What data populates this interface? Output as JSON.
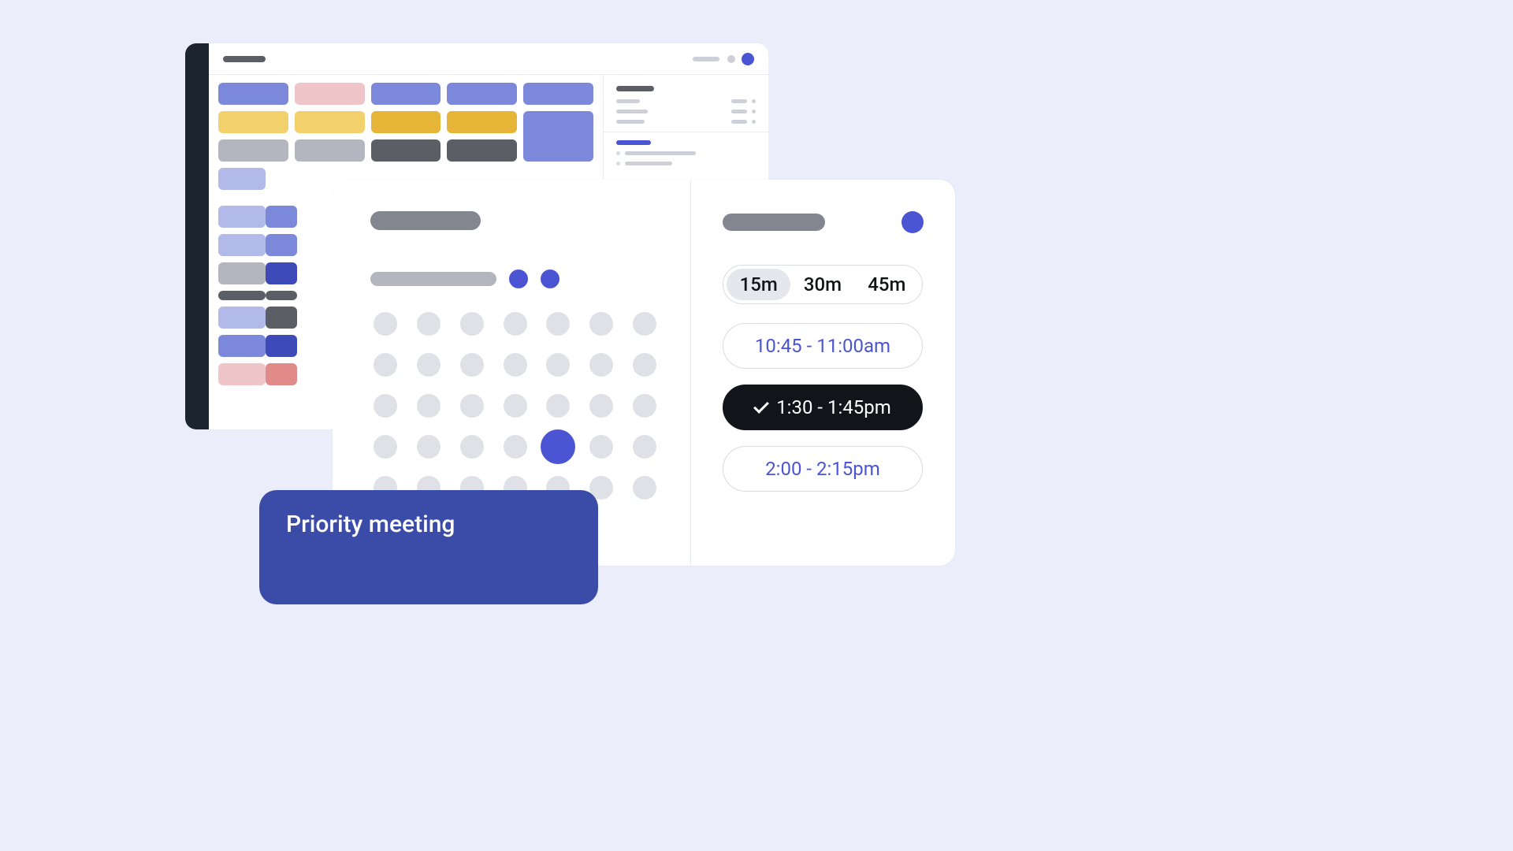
{
  "scheduler": {
    "durations": [
      "15m",
      "30m",
      "45m"
    ],
    "selected_duration_index": 0,
    "slots": [
      {
        "label": "10:45 - 11:00am",
        "selected": false
      },
      {
        "label": "1:30 - 1:45pm",
        "selected": true
      },
      {
        "label": "2:00 - 2:15pm",
        "selected": false
      }
    ],
    "calendar": {
      "selected_index": 25
    }
  },
  "priority_card": {
    "title": "Priority meeting"
  }
}
